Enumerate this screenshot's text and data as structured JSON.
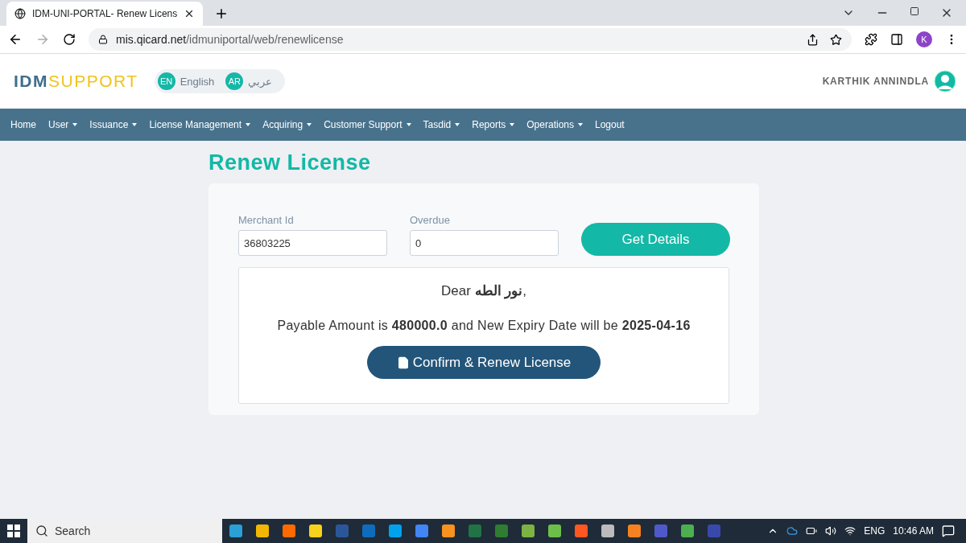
{
  "browser": {
    "tab_title": "IDM-UNI-PORTAL- Renew Licens",
    "url_host": "mis.qicard.net",
    "url_path": "/idmuniportal/web/renewlicense",
    "profile": "K"
  },
  "header": {
    "logo_strong": "IDM",
    "logo_light": "SUPPORT",
    "languages": [
      {
        "code": "EN",
        "label": "English"
      },
      {
        "code": "AR",
        "label": "عربي"
      }
    ],
    "user_name": "KARTHIK ANNINDLA"
  },
  "nav": [
    {
      "label": "Home",
      "dropdown": false
    },
    {
      "label": "User",
      "dropdown": true
    },
    {
      "label": "Issuance",
      "dropdown": true
    },
    {
      "label": "License Management",
      "dropdown": true
    },
    {
      "label": "Acquiring",
      "dropdown": true
    },
    {
      "label": "Customer Support",
      "dropdown": true
    },
    {
      "label": "Tasdid",
      "dropdown": true
    },
    {
      "label": "Reports",
      "dropdown": true
    },
    {
      "label": "Operations",
      "dropdown": true
    },
    {
      "label": "Logout",
      "dropdown": false
    }
  ],
  "page_title": "Renew License",
  "fields": [
    {
      "label": "Merchant Id",
      "value": "36803225"
    },
    {
      "label": "Overdue",
      "value": "0"
    }
  ],
  "get_details_button": "Get Details",
  "result": {
    "greeting": "Dear **نور الطه**,",
    "summary": "Payable Amount is **480000.0** and New Expiry Date will be **2025-04-16**",
    "confirm_button": "Confirm & Renew License"
  },
  "taskbar": {
    "search_placeholder": "Search",
    "language": "ENG",
    "time": "10:46 AM"
  }
}
